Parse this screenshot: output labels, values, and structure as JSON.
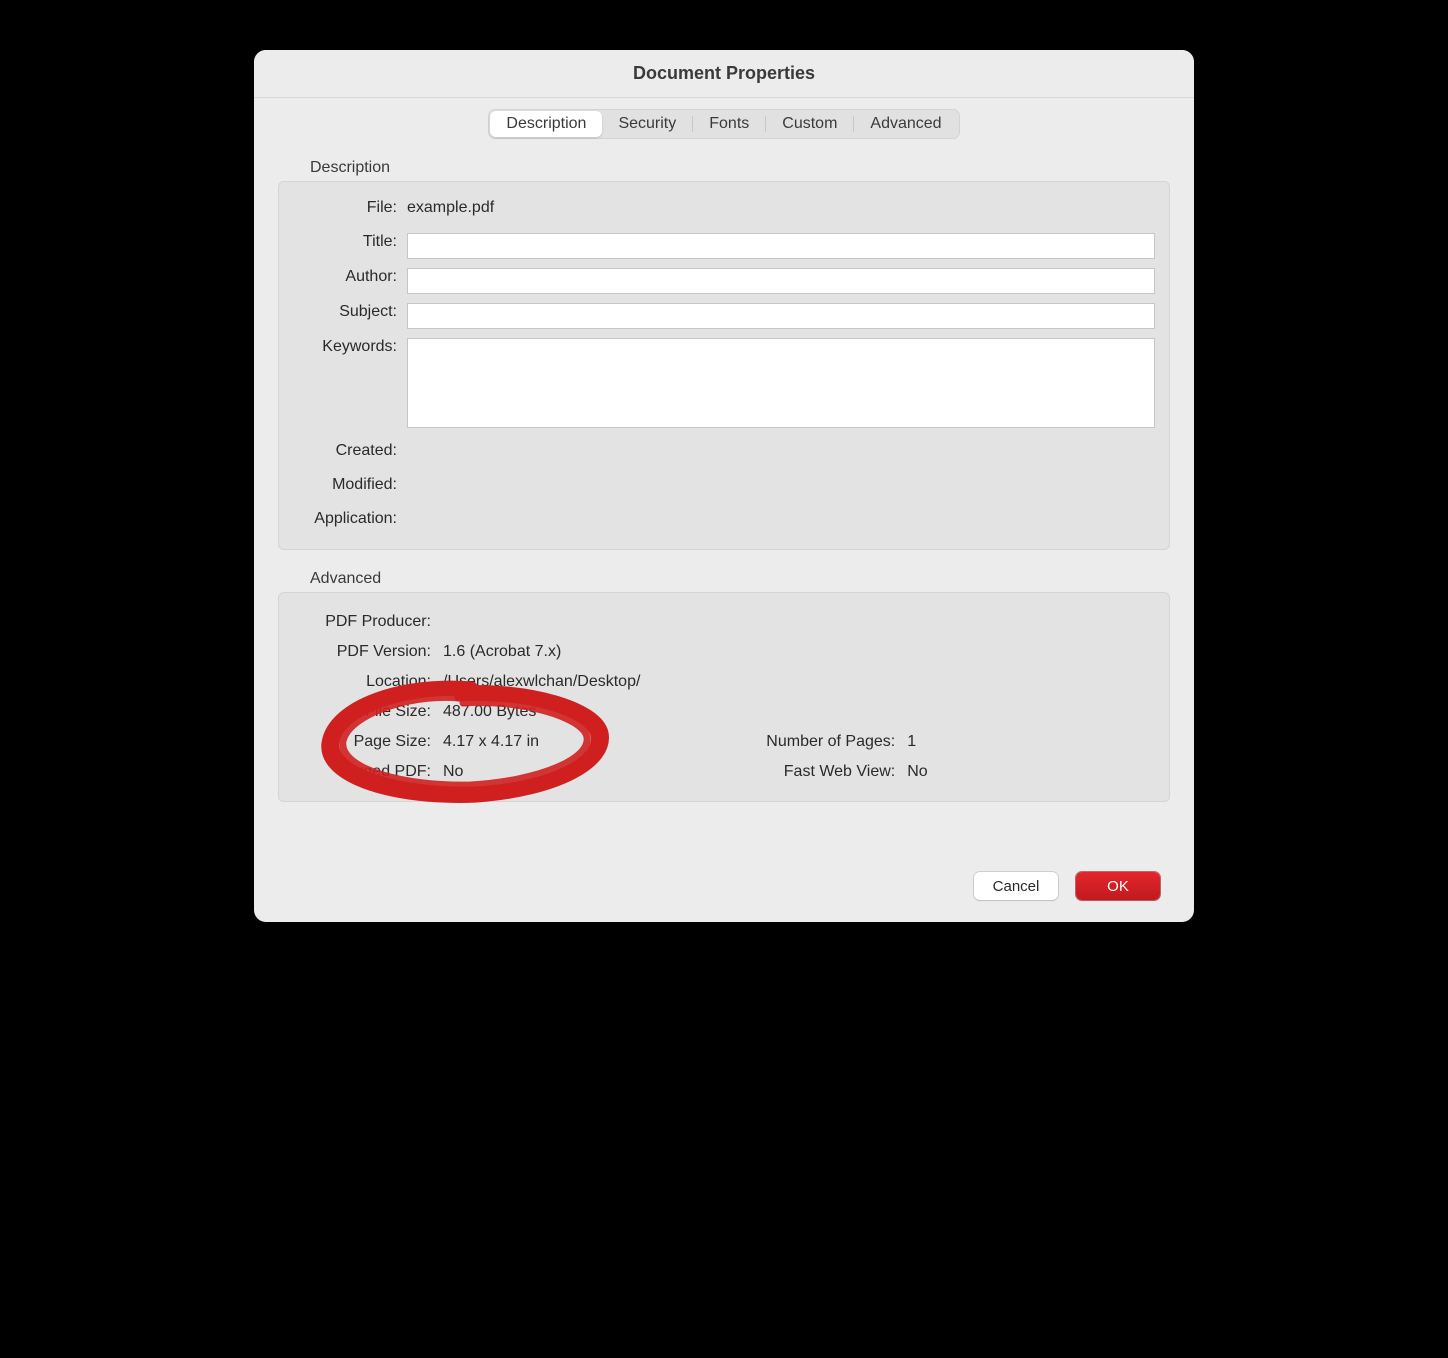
{
  "window": {
    "title": "Document Properties"
  },
  "tabs": {
    "description": "Description",
    "security": "Security",
    "fonts": "Fonts",
    "custom": "Custom",
    "advanced": "Advanced"
  },
  "description_section": {
    "heading": "Description",
    "file_label": "File:",
    "file_value": "example.pdf",
    "title_label": "Title:",
    "title_value": "",
    "author_label": "Author:",
    "author_value": "",
    "subject_label": "Subject:",
    "subject_value": "",
    "keywords_label": "Keywords:",
    "keywords_value": "",
    "created_label": "Created:",
    "created_value": "",
    "modified_label": "Modified:",
    "modified_value": "",
    "application_label": "Application:",
    "application_value": ""
  },
  "advanced_section": {
    "heading": "Advanced",
    "pdf_producer_label": "PDF Producer:",
    "pdf_producer_value": "",
    "pdf_version_label": "PDF Version:",
    "pdf_version_value": "1.6 (Acrobat 7.x)",
    "location_label": "Location:",
    "location_value": "/Users/alexwlchan/Desktop/",
    "file_size_label": "File Size:",
    "file_size_value": "487.00 Bytes",
    "page_size_label": "Page Size:",
    "page_size_value": "4.17 x 4.17 in",
    "num_pages_label": "Number of Pages:",
    "num_pages_value": "1",
    "tagged_pdf_label": "Tagged PDF:",
    "tagged_pdf_value": "No",
    "fast_web_label": "Fast Web View:",
    "fast_web_value": "No"
  },
  "buttons": {
    "cancel": "Cancel",
    "ok": "OK"
  }
}
